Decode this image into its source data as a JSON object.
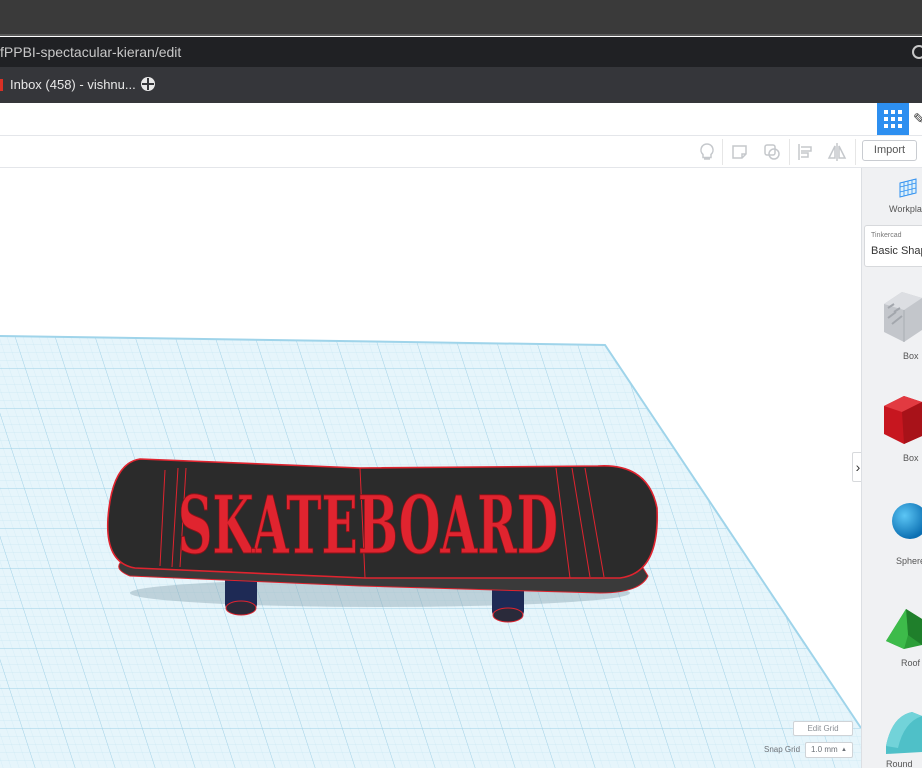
{
  "browser": {
    "url": "fPPBI-spectacular-kieran/edit",
    "bookmark_inbox": "Inbox (458) - vishnu..."
  },
  "toolbar": {
    "import_label": "Import",
    "icons": [
      "lightbulb-icon",
      "note-icon",
      "group-icon",
      "align-icon",
      "mirror-icon"
    ]
  },
  "viewport": {
    "model_text": "SKATEBOARD",
    "edit_grid_label": "Edit Grid",
    "snap_grid_label": "Snap Grid",
    "snap_grid_value": "1.0 mm"
  },
  "panel": {
    "workplane_label": "Workplane",
    "library_source": "Tinkercad",
    "library_name": "Basic Shapes",
    "shapes": [
      {
        "label": "Box",
        "color": "#bfc2c7",
        "kind": "box-hole"
      },
      {
        "label": "Box",
        "color": "#d7262e",
        "kind": "box"
      },
      {
        "label": "Sphere",
        "color": "#1a8fd6",
        "kind": "sphere"
      },
      {
        "label": "Roof",
        "color": "#2ea53a",
        "kind": "roof"
      },
      {
        "label": "Round Roof",
        "color": "#4fc0c8",
        "kind": "round-roof"
      }
    ]
  },
  "colors": {
    "accent": "#2d8ff0",
    "grid": "#bfe1ef",
    "board": "#2b2b2b",
    "text_red": "#e0242f"
  }
}
